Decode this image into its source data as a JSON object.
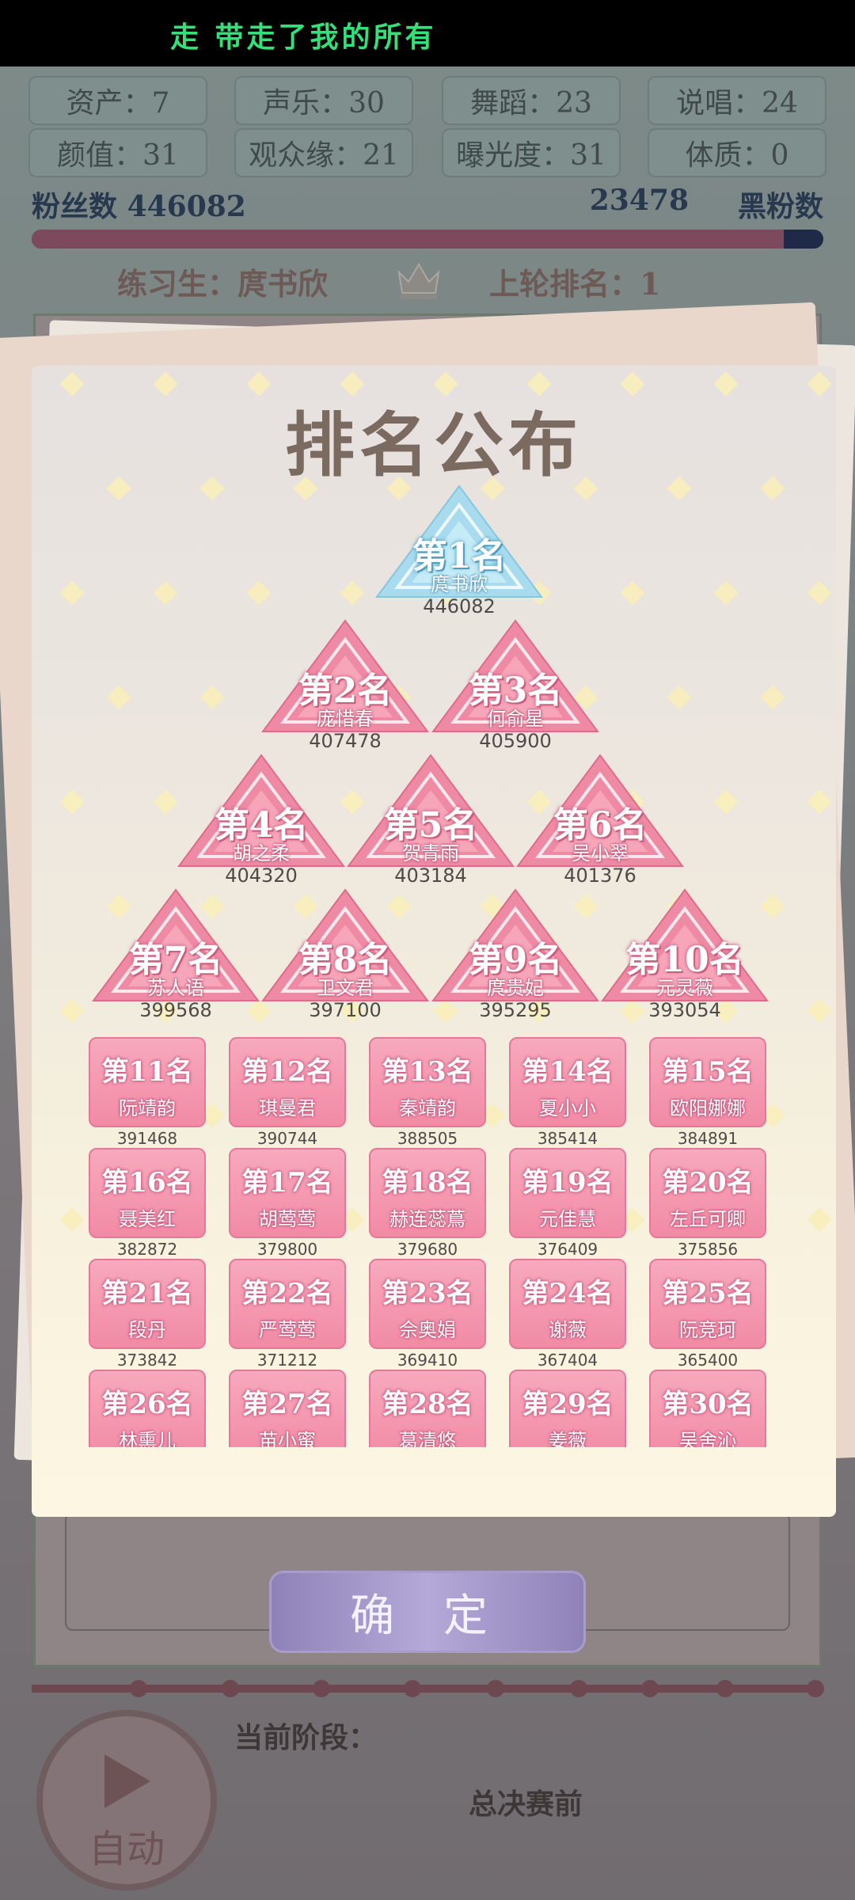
{
  "ticker": {
    "text": "走  带走了我的所有"
  },
  "stats": [
    {
      "label": "资产：7"
    },
    {
      "label": "声乐：30"
    },
    {
      "label": "舞蹈：23"
    },
    {
      "label": "说唱：24"
    },
    {
      "label": "颜值：31"
    },
    {
      "label": "观众缘：21"
    },
    {
      "label": "曝光度：31"
    },
    {
      "label": "体质：0"
    }
  ],
  "fans": {
    "label": "粉丝数",
    "value": "446082",
    "anti_value": "23478",
    "anti_label": "黑粉数",
    "ratio": 0.95
  },
  "trainee": {
    "label": "练习生：庹书欣"
  },
  "last_rank": {
    "label": "上轮排名：1"
  },
  "popup": {
    "title": "排名公布",
    "confirm": "确 定",
    "top10": [
      {
        "rank": "第1名",
        "name": "庹书欣",
        "score": "446082"
      },
      {
        "rank": "第2名",
        "name": "庞惜春",
        "score": "407478"
      },
      {
        "rank": "第3名",
        "name": "何俞星",
        "score": "405900"
      },
      {
        "rank": "第4名",
        "name": "胡之柔",
        "score": "404320"
      },
      {
        "rank": "第5名",
        "name": "贺青雨",
        "score": "403184"
      },
      {
        "rank": "第6名",
        "name": "吴小翠",
        "score": "401376"
      },
      {
        "rank": "第7名",
        "name": "苏人语",
        "score": "399568"
      },
      {
        "rank": "第8名",
        "name": "卫文君",
        "score": "397100"
      },
      {
        "rank": "第9名",
        "name": "庹贵妃",
        "score": "395295"
      },
      {
        "rank": "第10名",
        "name": "元灵薇",
        "score": "393054"
      }
    ],
    "rest": [
      {
        "rank": "第11名",
        "name": "阮靖韵",
        "score": "391468"
      },
      {
        "rank": "第12名",
        "name": "琪曼君",
        "score": "390744"
      },
      {
        "rank": "第13名",
        "name": "秦靖韵",
        "score": "388505"
      },
      {
        "rank": "第14名",
        "name": "夏小小",
        "score": "385414"
      },
      {
        "rank": "第15名",
        "name": "欧阳娜娜",
        "score": "384891"
      },
      {
        "rank": "第16名",
        "name": "聂美红",
        "score": "382872"
      },
      {
        "rank": "第17名",
        "name": "胡莺莺",
        "score": "379800"
      },
      {
        "rank": "第18名",
        "name": "赫连蕊蔦",
        "score": "379680"
      },
      {
        "rank": "第19名",
        "name": "元佳慧",
        "score": "376409"
      },
      {
        "rank": "第20名",
        "name": "左丘可卿",
        "score": "375856"
      },
      {
        "rank": "第21名",
        "name": "段丹",
        "score": "373842"
      },
      {
        "rank": "第22名",
        "name": "严莺莺",
        "score": "371212"
      },
      {
        "rank": "第23名",
        "name": "佘奥娟",
        "score": "369410"
      },
      {
        "rank": "第24名",
        "name": "谢薇",
        "score": "367404"
      },
      {
        "rank": "第25名",
        "name": "阮竞珂",
        "score": "365400"
      },
      {
        "rank": "第26名",
        "name": "林熏儿",
        "score": ""
      },
      {
        "rank": "第27名",
        "name": "苗小蜜",
        "score": ""
      },
      {
        "rank": "第28名",
        "name": "葛清悠",
        "score": ""
      },
      {
        "rank": "第29名",
        "name": "姜薇",
        "score": ""
      },
      {
        "rank": "第30名",
        "name": "吴舍沁",
        "score": ""
      }
    ]
  },
  "stage": {
    "label": "当前阶段：",
    "value": "总决赛前"
  },
  "auto": {
    "label": "自动"
  },
  "colors": {
    "pink": "#f28aa5",
    "gold_tri": "#bfe6f3",
    "confirm": "#a89ccb"
  }
}
